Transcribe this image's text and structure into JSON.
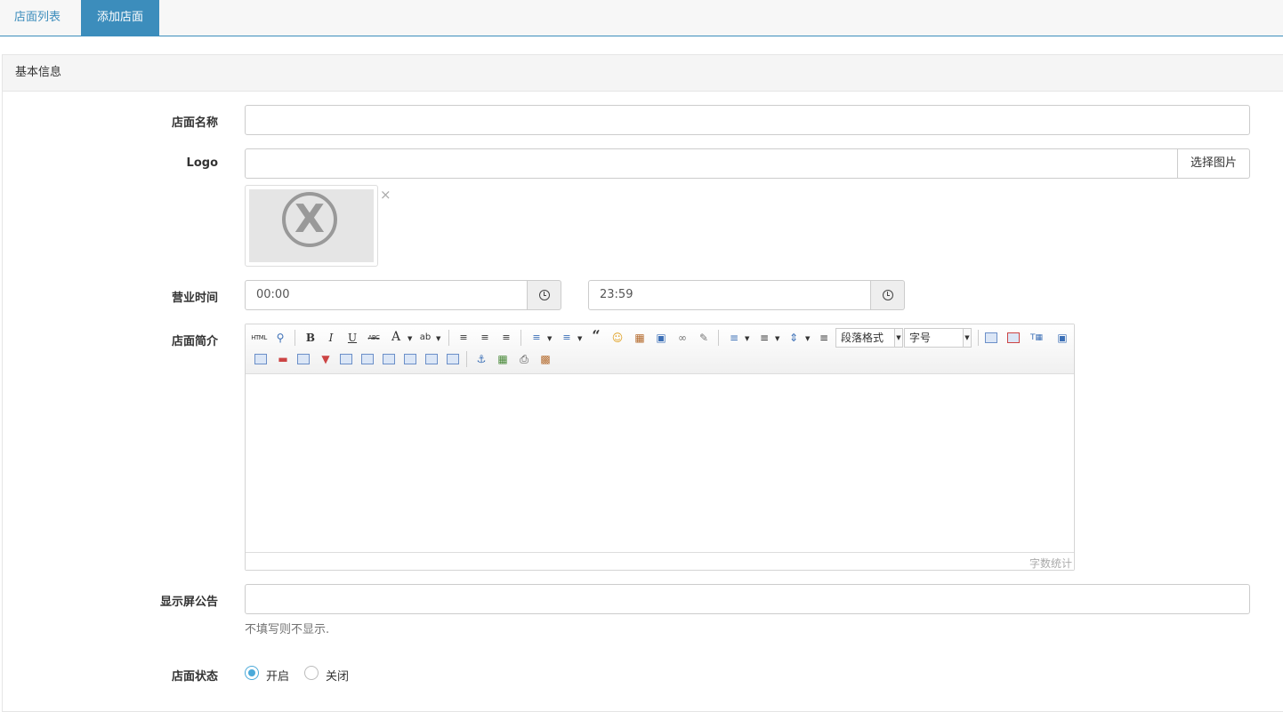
{
  "tabs": {
    "list_label": "店面列表",
    "add_label": "添加店面"
  },
  "panel": {
    "title": "基本信息"
  },
  "form": {
    "name_label": "店面名称",
    "name_value": "",
    "logo_label": "Logo",
    "logo_value": "",
    "logo_button": "选择图片",
    "logo_delete": "×",
    "hours_label": "营业时间",
    "open_time": "00:00",
    "close_time": "23:59",
    "intro_label": "店面简介",
    "notice_label": "显示屏公告",
    "notice_value": "",
    "notice_hint": "不填写则不显示.",
    "status_label": "店面状态",
    "status_on": "开启",
    "status_off": "关闭",
    "status_selected": "开启"
  },
  "editor": {
    "paragraph_format": "段落格式",
    "font_size": "字号",
    "word_count": "字数统计",
    "toolbar_buttons": [
      "html",
      "preview",
      "bold",
      "italic",
      "underline",
      "strikethrough",
      "font-color",
      "highlight",
      "align-left",
      "align-center",
      "align-right",
      "ordered-list",
      "unordered-list",
      "blockquote",
      "emoticon",
      "image",
      "video",
      "link",
      "unlink",
      "paragraph-spacing-top",
      "paragraph-spacing-bottom",
      "line-height",
      "indent",
      "table",
      "delete-table",
      "insert-caption",
      "preview-screen",
      "insert-row-above",
      "delete-row",
      "insert-column",
      "delete-column",
      "merge-cells",
      "merge-right",
      "merge-down",
      "split-cells",
      "split-rows",
      "split-columns",
      "anchor",
      "insert-image",
      "print",
      "paste-plain"
    ]
  },
  "toolbar_text": {
    "html": "HTML",
    "bold": "B",
    "italic": "I",
    "underline": "U",
    "strike": "ABC",
    "font_color": "A",
    "highlight": "ab",
    "quote": "66"
  }
}
